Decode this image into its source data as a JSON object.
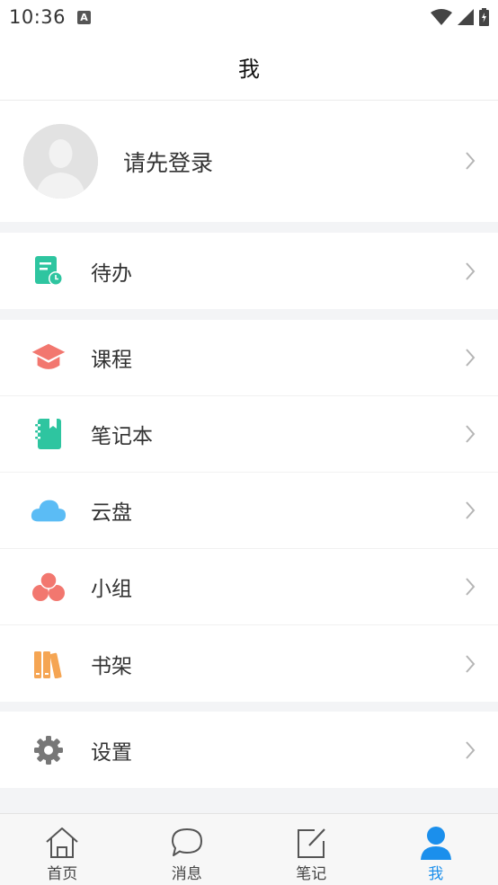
{
  "status_bar": {
    "time": "10:36",
    "notification_badge": "A"
  },
  "header": {
    "title": "我"
  },
  "profile": {
    "login_text": "请先登录"
  },
  "groups": [
    {
      "items": [
        {
          "key": "todo",
          "label": "待办",
          "icon": "todo-clock-icon"
        }
      ]
    },
    {
      "items": [
        {
          "key": "courses",
          "label": "课程",
          "icon": "graduation-cap-icon"
        },
        {
          "key": "notebook",
          "label": "笔记本",
          "icon": "notebook-icon"
        },
        {
          "key": "cloud",
          "label": "云盘",
          "icon": "cloud-icon"
        },
        {
          "key": "group",
          "label": "小组",
          "icon": "group-circles-icon"
        },
        {
          "key": "bookshelf",
          "label": "书架",
          "icon": "bookshelf-icon"
        }
      ]
    },
    {
      "items": [
        {
          "key": "settings",
          "label": "设置",
          "icon": "gear-icon"
        }
      ]
    }
  ],
  "tabs": [
    {
      "label": "首页",
      "icon": "home-icon",
      "active": false
    },
    {
      "label": "消息",
      "icon": "chat-bubble-icon",
      "active": false
    },
    {
      "label": "笔记",
      "icon": "edit-note-icon",
      "active": false
    },
    {
      "label": "我",
      "icon": "person-icon",
      "active": true
    }
  ],
  "colors": {
    "accent": "#1b8fec",
    "teal": "#2ec5a0",
    "coral": "#f2776f",
    "sky": "#5bbcf5",
    "orange": "#f5a553",
    "gray": "#777777"
  }
}
